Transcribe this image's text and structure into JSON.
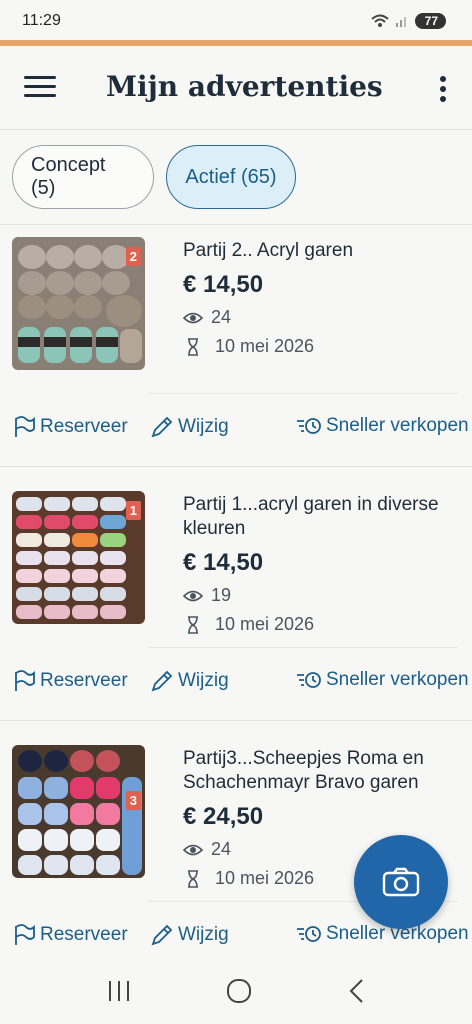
{
  "status": {
    "time": "11:29",
    "battery": "77"
  },
  "colors": {
    "accent": "#e8a56a",
    "primary": "#1b5e8a",
    "fab": "#2166a8"
  },
  "header": {
    "title": "Mijn advertenties",
    "menu_icon": "hamburger-icon",
    "more_icon": "more-vertical-icon"
  },
  "tabs": [
    {
      "label": "Concept (5)",
      "selected": false
    },
    {
      "label": "Actief (65)",
      "selected": true
    }
  ],
  "listings": [
    {
      "badge": "2",
      "title": "Partij 2.. Acryl garen",
      "price": "€ 14,50",
      "views": "24",
      "expires": "10 mei 2026"
    },
    {
      "badge": "1",
      "title": "Partij 1...acryl garen in diverse kleuren",
      "price": "€ 14,50",
      "views": "19",
      "expires": "10 mei 2026"
    },
    {
      "badge": "3",
      "title": "Partij3...Scheepjes Roma en Schachenmayr Bravo garen",
      "price": "€ 24,50",
      "views": "24",
      "expires": "10 mei 2026"
    }
  ],
  "actions": {
    "reserve": "Reserveer",
    "edit": "Wijzig",
    "boost": "Sneller verkopen"
  },
  "fab": {
    "icon": "camera-icon"
  }
}
